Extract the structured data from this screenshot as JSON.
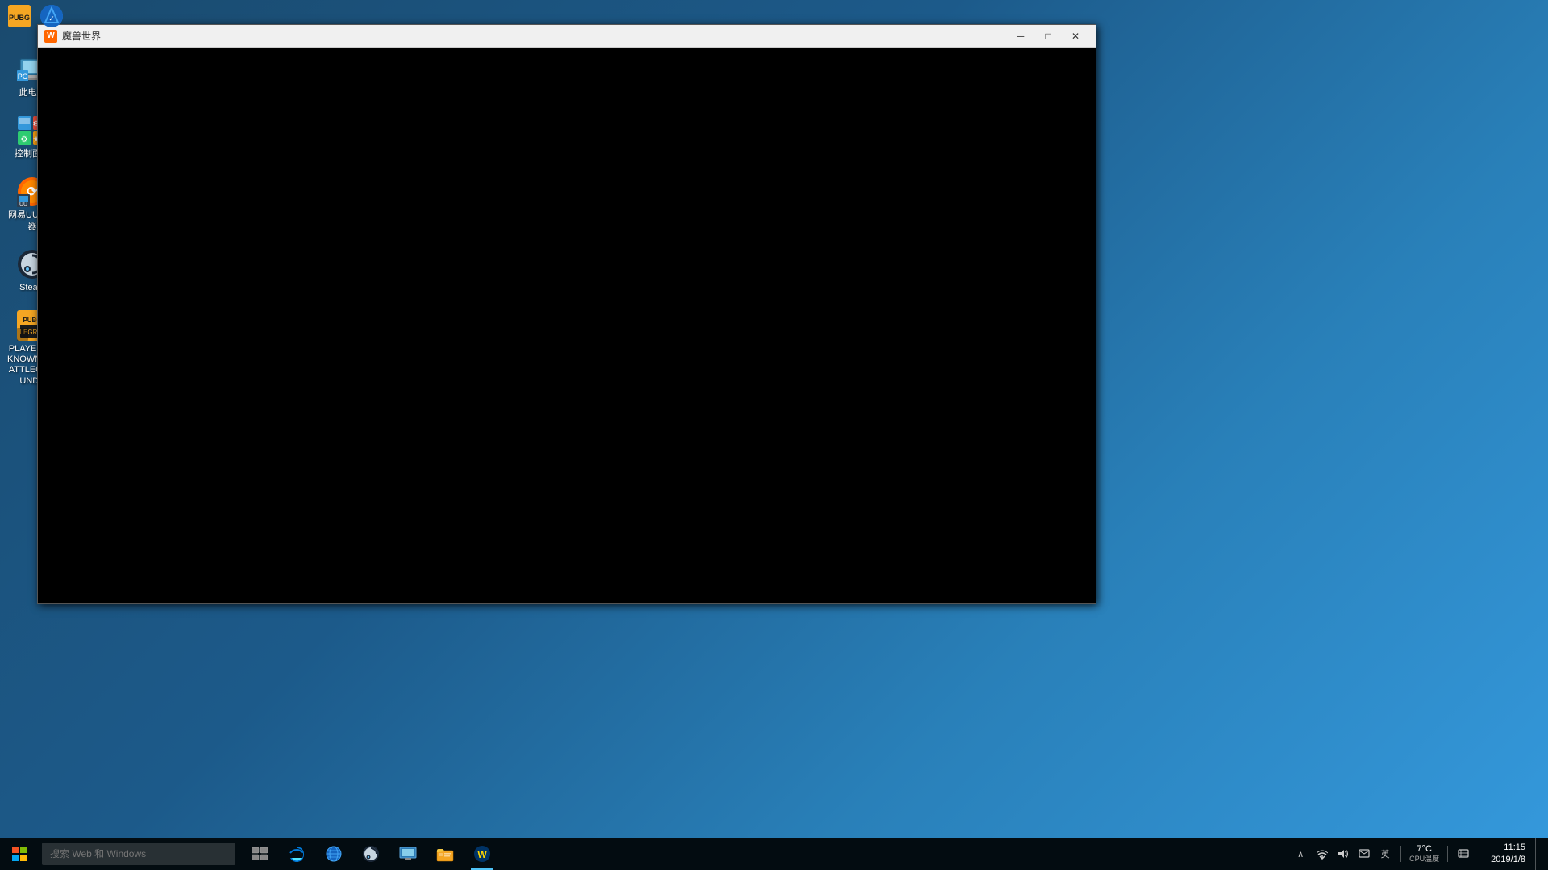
{
  "desktop": {
    "background": "blue-gradient"
  },
  "taskbar_top": {
    "icons": [
      {
        "id": "pubg-top",
        "label": "PUBG",
        "type": "pubg"
      },
      {
        "id": "arma-top",
        "label": "Arma Shield",
        "type": "arma"
      }
    ]
  },
  "desktop_icons": [
    {
      "id": "recycle-bin",
      "label": "此电脑",
      "type": "recycle"
    },
    {
      "id": "control-panel",
      "label": "控制面板",
      "type": "control"
    },
    {
      "id": "uu-accelerator",
      "label": "网易UU加速器",
      "type": "uu"
    },
    {
      "id": "steam",
      "label": "Steam",
      "type": "steam"
    },
    {
      "id": "pubg-desktop",
      "label": "PLAYERUNKNOWN'S BATTLEGROUNDS",
      "type": "pubg"
    }
  ],
  "window": {
    "title": "魔兽世界",
    "title_icon": "W",
    "content": "black-loading"
  },
  "window_controls": {
    "minimize": "─",
    "maximize": "□",
    "close": "✕"
  },
  "taskbar": {
    "start_icon": "⊞",
    "search_placeholder": "搜索 Web 和 Windows",
    "apps": [
      {
        "id": "task-view",
        "icon": "⧉",
        "active": false
      },
      {
        "id": "edge",
        "icon": "e",
        "active": false,
        "color": "#0078d7"
      },
      {
        "id": "ie",
        "icon": "ℯ",
        "active": false
      },
      {
        "id": "steam-taskbar",
        "icon": "♨",
        "active": false
      },
      {
        "id": "remote",
        "icon": "⊡",
        "active": false
      },
      {
        "id": "explorer",
        "icon": "📁",
        "active": false
      },
      {
        "id": "wow-taskbar",
        "icon": "W",
        "active": true
      }
    ],
    "system_tray": {
      "expand": "∧",
      "icons": [
        "🔊",
        "🌐",
        "💬",
        "⌨"
      ],
      "cpu_temp": "7°C",
      "cpu_label": "CPU温度"
    },
    "time": "11:15",
    "date": "2019/1/8"
  }
}
